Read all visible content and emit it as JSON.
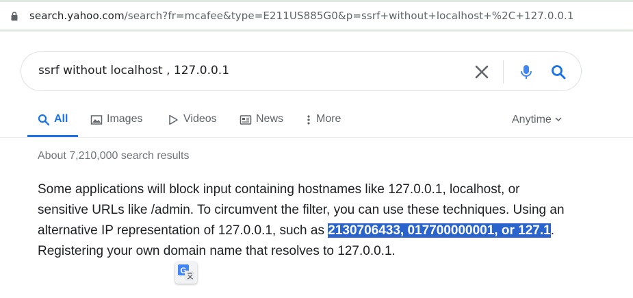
{
  "browser": {
    "url_host": "search.yahoo.com",
    "url_rest": "/search?fr=mcafee&type=E211US885G0&p=ssrf+without+localhost+%2C+127.0.0.1"
  },
  "search": {
    "query": "ssrf without localhost , 127.0.0.1"
  },
  "tabs": [
    {
      "label": "All",
      "icon": "search-icon",
      "active": true
    },
    {
      "label": "Images",
      "icon": "image-icon"
    },
    {
      "label": "Videos",
      "icon": "play-icon"
    },
    {
      "label": "News",
      "icon": "newspaper-icon"
    },
    {
      "label": "More",
      "icon": "more-vertical-icon"
    }
  ],
  "filters": {
    "anytime_label": "Anytime"
  },
  "results": {
    "count_text": "About 7,210,000 search results",
    "snippet": {
      "before": "Some applications will block input containing hostnames like 127.0.0.1, localhost, or sensitive URLs like /admin. To circumvent the filter, you can use these techniques. Using an alternative IP representation of 127.0.0.1, such as ",
      "highlight": "2130706433, 017700000001, or 127.1",
      "after": ". Registering your own domain name that resolves to 127.0.0.1."
    }
  },
  "colors": {
    "accent": "#1a73e8",
    "highlight_bg": "#2a63cc",
    "mic": "#4285f4"
  }
}
